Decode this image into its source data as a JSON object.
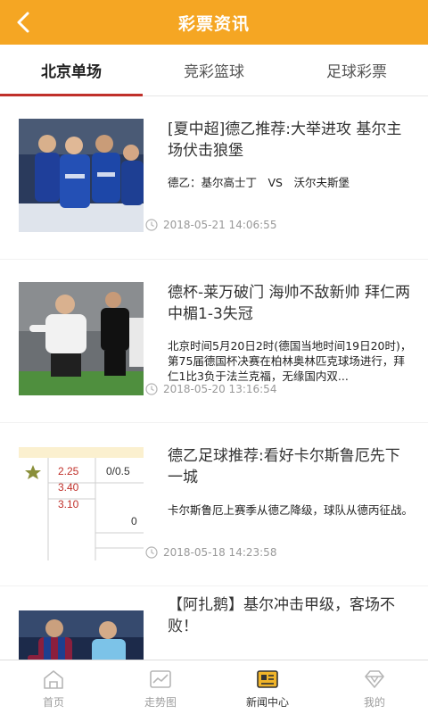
{
  "header": {
    "title": "彩票资讯"
  },
  "tabs": [
    {
      "label": "北京单场",
      "active": true
    },
    {
      "label": "竞彩篮球",
      "active": false
    },
    {
      "label": "足球彩票",
      "active": false
    }
  ],
  "news": [
    {
      "title": "[夏中超]德乙推荐:大举进攻 基尔主场伏击狼堡",
      "summary": "德乙：基尔高士丁　VS　沃尔夫斯堡",
      "time": "2018-05-21 14:06:55"
    },
    {
      "title": "德杯-莱万破门 海帅不敌新帅 拜仁两中楣1-3失冠",
      "summary": "北京时间5月20日2时(德国当地时间19日20时)，第75届德国杯决赛在柏林奥林匹克球场进行，拜仁1比3负于法兰克福，无缘国内双...",
      "time": "2018-05-20 13:16:54"
    },
    {
      "title": "德乙足球推荐:看好卡尔斯鲁厄先下一城",
      "summary": "卡尔斯鲁厄上赛季从德乙降级，球队从德丙征战。",
      "time": "2018-05-18 14:23:58",
      "odds": {
        "row1": "2.25",
        "row2": "3.40",
        "row3": "3.10",
        "handicap": "0/0.5",
        "zero": "0"
      }
    },
    {
      "title": "【阿扎鹅】基尔冲击甲级，客场不败！",
      "summary": "",
      "time": ""
    }
  ],
  "bottom_nav": [
    {
      "label": "首页",
      "icon": "home-icon",
      "active": false
    },
    {
      "label": "走势图",
      "icon": "trend-chart-icon",
      "active": false
    },
    {
      "label": "新闻中心",
      "icon": "newspaper-icon",
      "active": true
    },
    {
      "label": "我的",
      "icon": "profile-diamond-icon",
      "active": false
    }
  ],
  "colors": {
    "header": "#f5a623",
    "tab_indicator": "#c0302a",
    "odds_red": "#c0302a",
    "nav_active_icon": "#f0b429"
  }
}
